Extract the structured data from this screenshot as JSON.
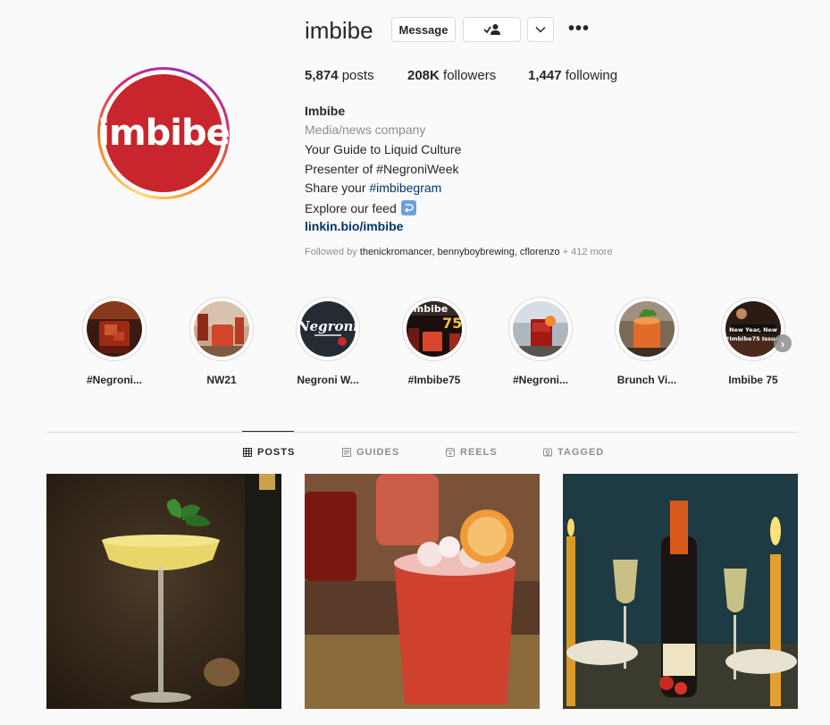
{
  "profile": {
    "username": "imbibe",
    "avatar_text": "imbibe",
    "buttons": {
      "message": "Message"
    },
    "stats": {
      "posts_count": "5,874",
      "posts_label": " posts",
      "followers_count": "208K",
      "followers_label": " followers",
      "following_count": "1,447",
      "following_label": " following"
    },
    "bio": {
      "name": "Imbibe",
      "category": "Media/news company",
      "line1": "Your Guide to Liquid Culture",
      "line2": "Presenter of #NegroniWeek",
      "line3_prefix": "Share your ",
      "line3_hashtag": "#imbibegram",
      "line4": "Explore our feed",
      "link": "linkin.bio/imbibe"
    },
    "followed_by": {
      "prefix": "Followed by ",
      "names": "thenickromancer, bennyboybrewing, cflorenzo",
      "more": " + 412 more"
    }
  },
  "highlights": [
    {
      "label": "#Negroni..."
    },
    {
      "label": "NW21"
    },
    {
      "label": "Negroni W..."
    },
    {
      "label": "#Imbibe75"
    },
    {
      "label": "#Negroni..."
    },
    {
      "label": "Brunch Vi..."
    },
    {
      "label": "Imbibe 75"
    }
  ],
  "tabs": [
    {
      "label": "POSTS",
      "active": true,
      "icon": "grid-icon"
    },
    {
      "label": "GUIDES",
      "active": false,
      "icon": "guides-icon"
    },
    {
      "label": "REELS",
      "active": false,
      "icon": "reels-icon"
    },
    {
      "label": "TAGGED",
      "active": false,
      "icon": "tagged-icon"
    }
  ],
  "highlight_text": {
    "negroni_logo": "Negroni",
    "imbibe_mag": "imbibe",
    "imbibe_75": "75",
    "new_year": "New Year, New",
    "issue": "#Imbibe75 Issue!"
  },
  "colors": {
    "brand_red": "#c9252c",
    "link_blue": "#00376b",
    "muted": "#8e8e8e"
  }
}
